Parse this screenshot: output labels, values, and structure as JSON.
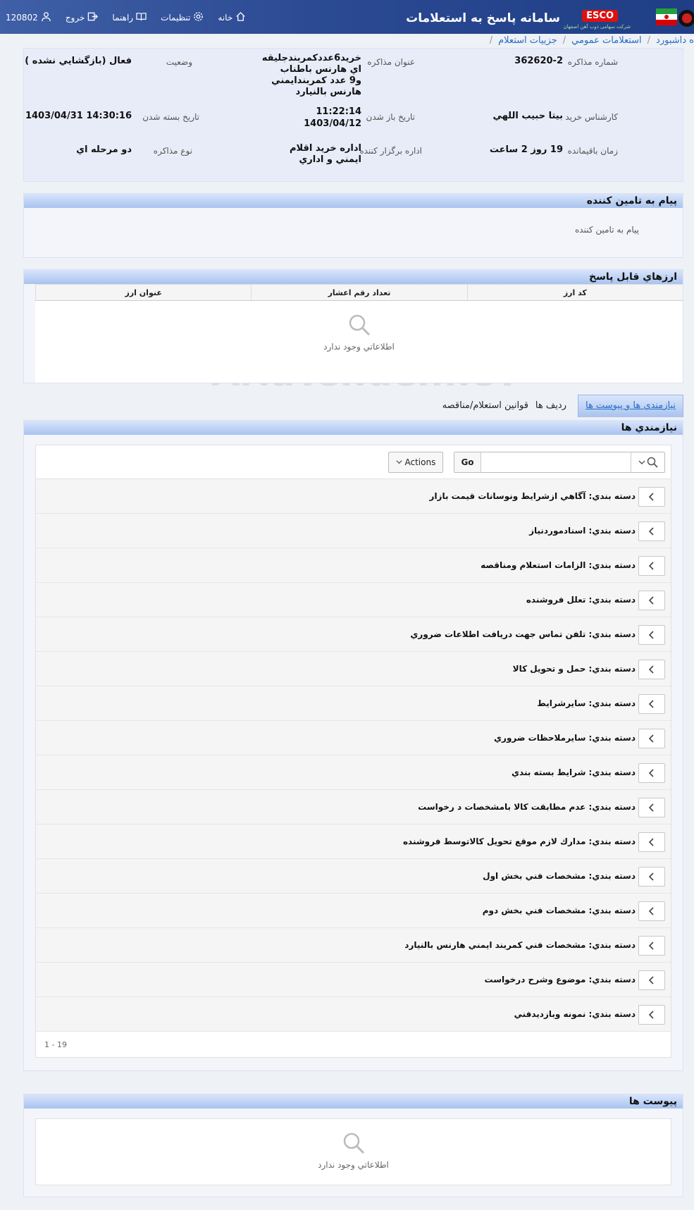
{
  "header": {
    "title": "سامانه پاسخ به استعلامات",
    "brand": "ESCO",
    "brand_sub": "شركت سهامی ذوب آهن اصفهان",
    "nav": {
      "home": "خانه",
      "settings": "تنظیمات",
      "help": "راهنما",
      "logout": "خروج",
      "user": "120802"
    }
  },
  "breadcrumb": [
    "ه داشبورد",
    "استعلامات عمومي",
    "جزييات استعلام"
  ],
  "info": {
    "labels": {
      "number": "شماره مذاكره",
      "subject": "عنوان مذاكره",
      "status": "وضعيت",
      "buyer": "كارشناس خريد",
      "open_date": "تاريخ باز شدن",
      "close_date": "تاريخ بسته شدن",
      "remaining": "زمان باقيمانده",
      "office": "اداره برگزار كننده",
      "type": "نوع مذاكره"
    },
    "values": {
      "number": "362620-2",
      "subject": "خريد6عددكمربندجليقه اي هارنس باطناب و9 عدد كمربندايمني هارنس بالنيارد",
      "status": "فعال (بازگشايي نشده )",
      "buyer": "بيتا حبيب اللهي",
      "open_date_time": "11:22:14",
      "open_date_day": "1403/04/12",
      "close_date": "1403/04/31 14:30:16",
      "remaining": "19 روز 2 ساعت",
      "office": "اداره خريد اقلام ايمني و اداري",
      "type": "دو مرحله اي"
    }
  },
  "supplier_message": {
    "title": "پيام به تامين كننده",
    "label": "پيام به تامين كننده"
  },
  "currencies": {
    "title": "ارزهاي قابل پاسخ",
    "columns": [
      "كد ارز",
      "تعداد رقم اعشار",
      "عنوان ارز"
    ],
    "empty": "اطلاعاتي وجود ندارد"
  },
  "watermark": "AriaTender.neT",
  "tabs": {
    "active": "نيازمندي ها و پيوست ها",
    "items": "رديف ها",
    "rules": "قوانين استعلام/مناقصه"
  },
  "requirements": {
    "title": "نيازمندي ها",
    "go": "Go",
    "actions": "Actions",
    "search_placeholder": "",
    "groups": [
      "دسته بندي: آگاهي ازشرايط ونوسانات قيمت بازار",
      "دسته بندي: اسنادموردنياز",
      "دسته بندي: الزامات استعلام ومناقصه",
      "دسته بندي: تعلل فروشنده",
      "دسته بندي: تلفن تماس جهت دريافت اطلاعات ضروري",
      "دسته بندي: حمل و تحويل كالا",
      "دسته بندي: سايرشرايط",
      "دسته بندي: سايرملاحظات ضروري",
      "دسته بندي: شرايط بسته بندي",
      "دسته بندي: عدم مطابقت كالا بامشخصات د رخواست",
      "دسته بندي: مدارك لازم موقع تحويل كالاتوسط فروشنده",
      "دسته بندي: مشخصات فني بخش اول",
      "دسته بندي: مشخصات فني بخش دوم",
      "دسته بندي: مشخصات فني كمربند ايمني هارنس بالنيارد",
      "دسته بندي: موضوع وشرح درخواست",
      "دسته بندي: نمونه وبازديدفني"
    ],
    "pager": "1 - 19"
  },
  "attachments": {
    "title": "پيوست ها",
    "empty": "اطلاعاتي وجود ندارد"
  }
}
